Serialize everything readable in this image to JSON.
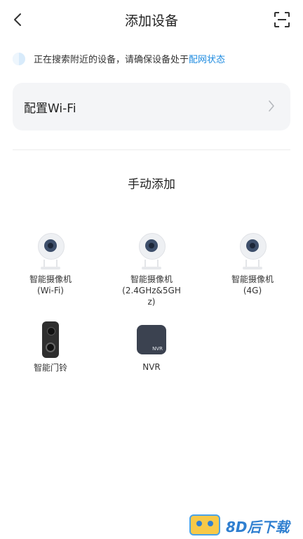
{
  "header": {
    "title": "添加设备"
  },
  "search_status": {
    "text": "正在搜索附近的设备，请确保设备处于",
    "link": "配网状态"
  },
  "wifi": {
    "label": "配置Wi-Fi"
  },
  "manual": {
    "title": "手动添加"
  },
  "devices": [
    {
      "name": "智能摄像机",
      "sub": "(Wi-Fi)"
    },
    {
      "name": "智能摄像机",
      "sub": "(2.4GHz&5GH",
      "sub2": "z)"
    },
    {
      "name": "智能摄像机",
      "sub": "(4G)"
    },
    {
      "name": "智能门铃"
    },
    {
      "name": "NVR",
      "icon_text": "NVR"
    }
  ],
  "watermark": {
    "text": "8D后下载"
  },
  "colors": {
    "accent": "#1e8be0",
    "card_bg": "#f4f5f7"
  }
}
